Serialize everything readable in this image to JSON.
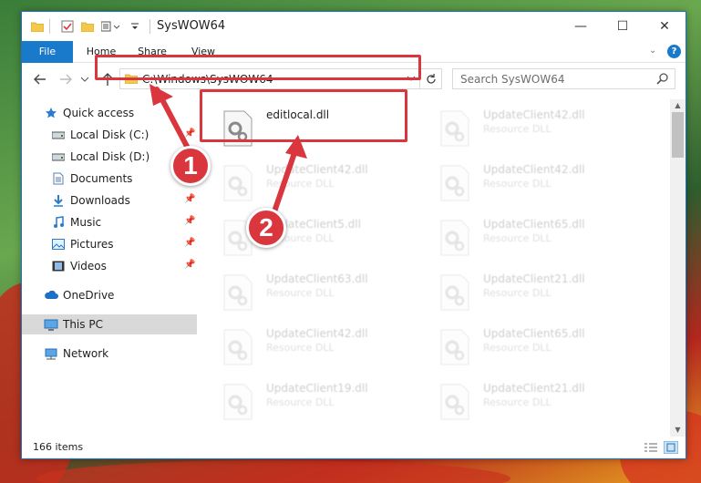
{
  "window": {
    "title": "SysWOW64",
    "controls": {
      "minimize": "—",
      "maximize": "☐",
      "close": "✕"
    }
  },
  "ribbon": {
    "tabs": [
      {
        "label": "File"
      },
      {
        "label": "Home"
      },
      {
        "label": "Share"
      },
      {
        "label": "View"
      }
    ]
  },
  "nav": {
    "address": "C:\\Windows\\SysWOW64",
    "search_placeholder": "Search SysWOW64"
  },
  "sidebar": {
    "items": [
      {
        "label": "Quick access",
        "icon": "star-icon",
        "pinned": false
      },
      {
        "label": "Local Disk (C:)",
        "icon": "drive-icon",
        "pinned": true
      },
      {
        "label": "Local Disk (D:)",
        "icon": "drive-icon",
        "pinned": false
      },
      {
        "label": "Documents",
        "icon": "documents-icon",
        "pinned": true
      },
      {
        "label": "Downloads",
        "icon": "downloads-icon",
        "pinned": true
      },
      {
        "label": "Music",
        "icon": "music-icon",
        "pinned": true
      },
      {
        "label": "Pictures",
        "icon": "pictures-icon",
        "pinned": true
      },
      {
        "label": "Videos",
        "icon": "videos-icon",
        "pinned": true
      },
      {
        "label": "OneDrive",
        "icon": "cloud-icon",
        "pinned": false
      },
      {
        "label": "This PC",
        "icon": "computer-icon",
        "pinned": false,
        "selected": true
      },
      {
        "label": "Network",
        "icon": "network-icon",
        "pinned": false
      }
    ]
  },
  "files": [
    {
      "name": "editlocal.dll",
      "type": "",
      "highlighted": true
    },
    {
      "name": "UpdateClient42.dll",
      "type": "Resource DLL"
    },
    {
      "name": "UpdateClient42.dll",
      "type": "Resource DLL"
    },
    {
      "name": "UpdateClient42.dll",
      "type": "Resource DLL"
    },
    {
      "name": "UpdateClient5.dll",
      "type": "Resource DLL"
    },
    {
      "name": "UpdateClient65.dll",
      "type": "Resource DLL"
    },
    {
      "name": "UpdateClient63.dll",
      "type": "Resource DLL"
    },
    {
      "name": "UpdateClient21.dll",
      "type": "Resource DLL"
    },
    {
      "name": "UpdateClient42.dll",
      "type": "Resource DLL"
    },
    {
      "name": "UpdateClient65.dll",
      "type": "Resource DLL"
    },
    {
      "name": "UpdateClient19.dll",
      "type": "Resource DLL"
    },
    {
      "name": "UpdateClient21.dll",
      "type": "Resource DLL"
    }
  ],
  "status": {
    "item_count": "166 items"
  },
  "callouts": [
    {
      "number": "1"
    },
    {
      "number": "2"
    }
  ],
  "colors": {
    "accent": "#1979ca",
    "callout": "#d9363e"
  }
}
